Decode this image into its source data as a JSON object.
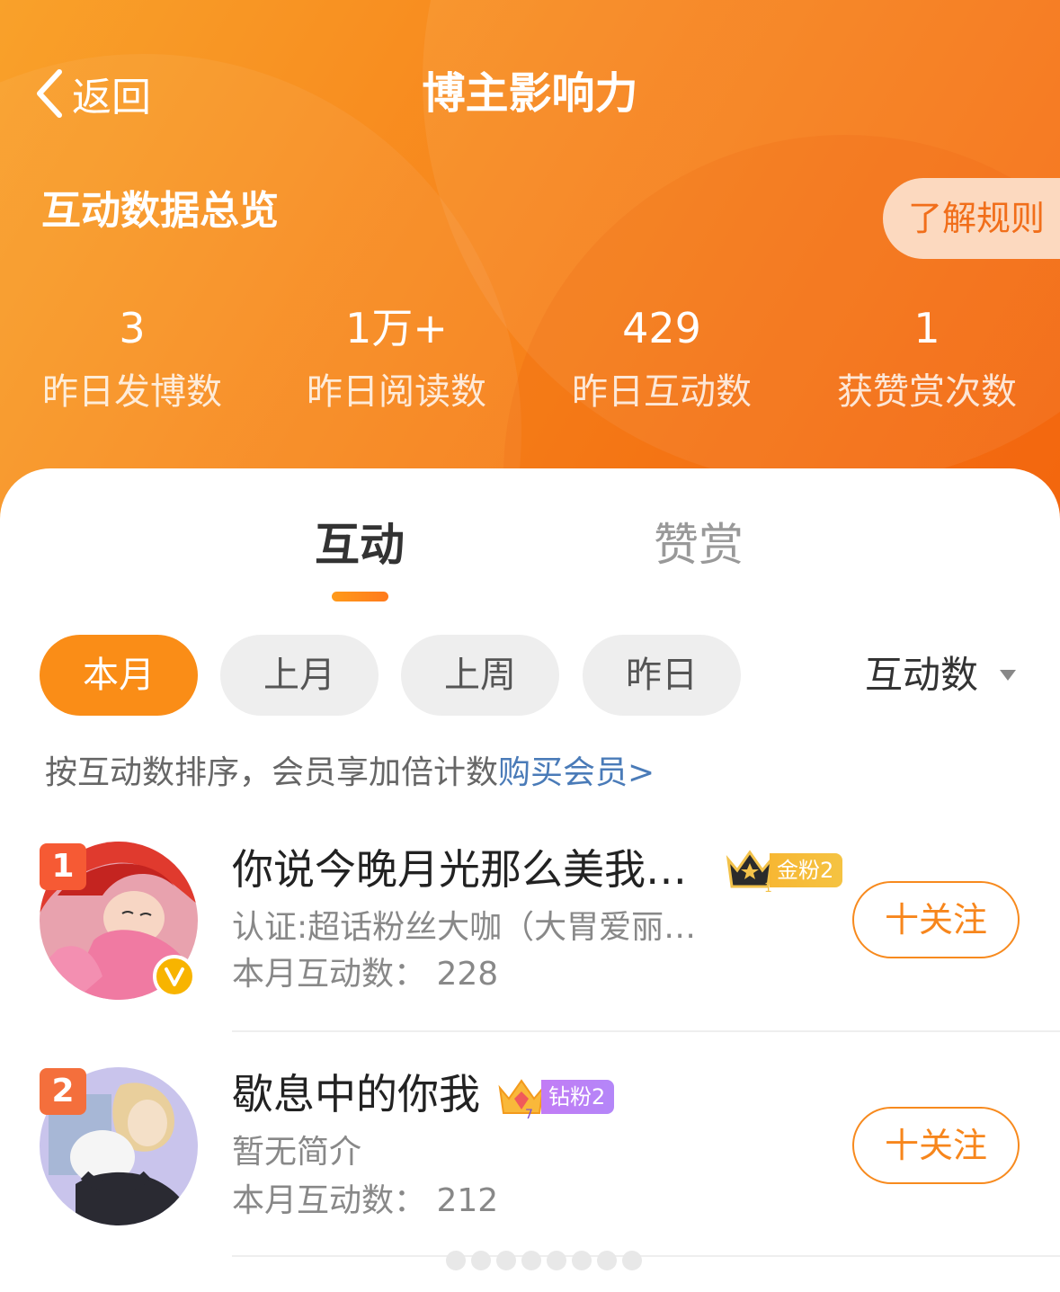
{
  "header": {
    "back_label": "返回",
    "title": "博主影响力",
    "overview_title": "互动数据总览",
    "rules_label": "了解规则",
    "gradient_colors": [
      "#f9a12a",
      "#f56a10"
    ]
  },
  "stats": [
    {
      "value": "3",
      "label": "昨日发博数"
    },
    {
      "value": "1万+",
      "label": "昨日阅读数"
    },
    {
      "value": "429",
      "label": "昨日互动数"
    },
    {
      "value": "1",
      "label": "获赞赏次数"
    }
  ],
  "tabs": [
    {
      "label": "互动",
      "active": true
    },
    {
      "label": "赞赏",
      "active": false
    }
  ],
  "filters": {
    "periods": [
      "本月",
      "上月",
      "上周",
      "昨日"
    ],
    "selected": "本月",
    "sort_label": "互动数",
    "accent_color": "#fa8d17"
  },
  "hint": {
    "text": "按互动数排序，会员享加倍计数",
    "link": "购买会员>"
  },
  "list": [
    {
      "rank": "1",
      "name": "你说今晚月光那么美我…",
      "fan_badge": "金粉2",
      "fan_level": "1",
      "desc": "认证:超话粉丝大咖（大胃爱丽…",
      "count": "本月互动数：  228",
      "follow_label": "十关注",
      "verified": true
    },
    {
      "rank": "2",
      "name": "歇息中的你我",
      "fan_badge": "钻粉2",
      "fan_level": "7",
      "desc": "暂无简介",
      "count": "本月互动数：  212",
      "follow_label": "十关注",
      "verified": false
    }
  ]
}
